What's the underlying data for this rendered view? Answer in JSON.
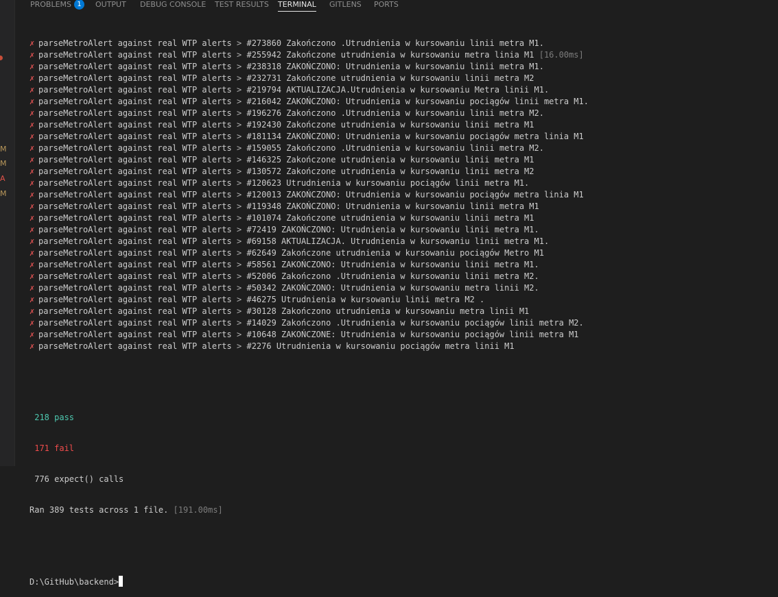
{
  "tabs": [
    {
      "label": "PROBLEMS",
      "badge": "1"
    },
    {
      "label": "OUTPUT"
    },
    {
      "label": "DEBUG CONSOLE"
    },
    {
      "label": "TEST RESULTS"
    },
    {
      "label": "TERMINAL",
      "active": true
    },
    {
      "label": "GITLENS"
    },
    {
      "label": "PORTS"
    }
  ],
  "left_strip": {
    "badges": [
      "M",
      "M",
      "A",
      "M"
    ]
  },
  "terminal": {
    "fail_mark": "✗",
    "test_prefix": "parseMetroAlert against real WTP alerts",
    "separator": ">",
    "lines": [
      {
        "title": "#273860 Zakończono .Utrudnienia w kursowaniu linii metra M1.",
        "timing": ""
      },
      {
        "title": "#255942 Zakończone utrudnienia w kursowaniu metra linia M1",
        "timing": "[16.00ms]"
      },
      {
        "title": "#238318 ZAKOŃCZONO: Utrudnienia w kursowaniu linii metra M1.",
        "timing": ""
      },
      {
        "title": "#232731 Zakończone utrudnienia w kursowaniu linii metra M2",
        "timing": ""
      },
      {
        "title": "#219794 AKTUALIZACJA.Utrudnienia w kursowaniu Metra linii M1.",
        "timing": ""
      },
      {
        "title": "#216042 ZAKOŃCZONO: Utrudnienia w kursowaniu pociągów linii metra M1.",
        "timing": ""
      },
      {
        "title": "#196276 Zakończono .Utrudnienia w kursowaniu linii metra M2.",
        "timing": ""
      },
      {
        "title": "#192430 Zakończone utrudnienia w kursowaniu linii metra M1",
        "timing": ""
      },
      {
        "title": "#181134 ZAKOŃCZONO: Utrudnienia w kursowaniu pociągów metra linia M1",
        "timing": ""
      },
      {
        "title": "#159055 Zakończono .Utrudnienia w kursowaniu linii metra M2.",
        "timing": ""
      },
      {
        "title": "#146325 Zakończone utrudnienia w kursowaniu linii metra M1",
        "timing": ""
      },
      {
        "title": "#130572 Zakończone utrudnienia w kursowaniu linii metra M2",
        "timing": ""
      },
      {
        "title": "#120623 Utrudnienia w kursowaniu pociągów linii metra M1.",
        "timing": ""
      },
      {
        "title": "#120013 ZAKOŃCZONO: Utrudnienia w kursowaniu pociągów metra linia M1",
        "timing": ""
      },
      {
        "title": "#119348 ZAKOŃCZONO: Utrudnienia w kursowaniu linii metra M1",
        "timing": ""
      },
      {
        "title": "#101074 Zakończone utrudnienia w kursowaniu linii metra M1",
        "timing": ""
      },
      {
        "title": "#72419 ZAKOŃCZONO: Utrudnienia w kursowaniu linii metra M1.",
        "timing": ""
      },
      {
        "title": "#69158 AKTUALIZACJA. Utrudnienia w kursowaniu linii metra M1.",
        "timing": ""
      },
      {
        "title": "#62649 Zakończone utrudnienia w kursowaniu pociągów Metro M1",
        "timing": ""
      },
      {
        "title": "#58561 ZAKOŃCZONO: Utrudnienia w kursowaniu linii metra M1.",
        "timing": ""
      },
      {
        "title": "#52006 Zakończono .Utrudnienia w kursowaniu linii metra M2.",
        "timing": ""
      },
      {
        "title": "#50342 ZAKOŃCZONO: Utrudnienia w kursowaniu metra linii M2.",
        "timing": ""
      },
      {
        "title": "#46275 Utrudnienia w kursowaniu linii metra M2 .",
        "timing": ""
      },
      {
        "title": "#30128 Zakończono utrudnienia w kursowaniu metra linii M1",
        "timing": ""
      },
      {
        "title": "#14029 Zakończono .Utrudnienia w kursowaniu pociągów linii metra M2.",
        "timing": ""
      },
      {
        "title": "#10648 ZAKOŃCZONE: Utrudnienia w kursowaniu pociągów linii metra M1",
        "timing": ""
      },
      {
        "title": "#2276 Utrudnienia w kursowaniu pociągów metra linii M1",
        "timing": ""
      }
    ],
    "summary": {
      "pass": "218 pass",
      "fail": "171 fail",
      "expect": "776 expect() calls",
      "ran": "Ran 389 tests across 1 file.",
      "ran_timing": "[191.00ms]"
    },
    "prompt": "D:\\GitHub\\backend>"
  },
  "colors": {
    "background": "#1e1e1e",
    "fail": "#f14c4c",
    "pass": "#4ec9b0",
    "badge": "#0078d4"
  }
}
